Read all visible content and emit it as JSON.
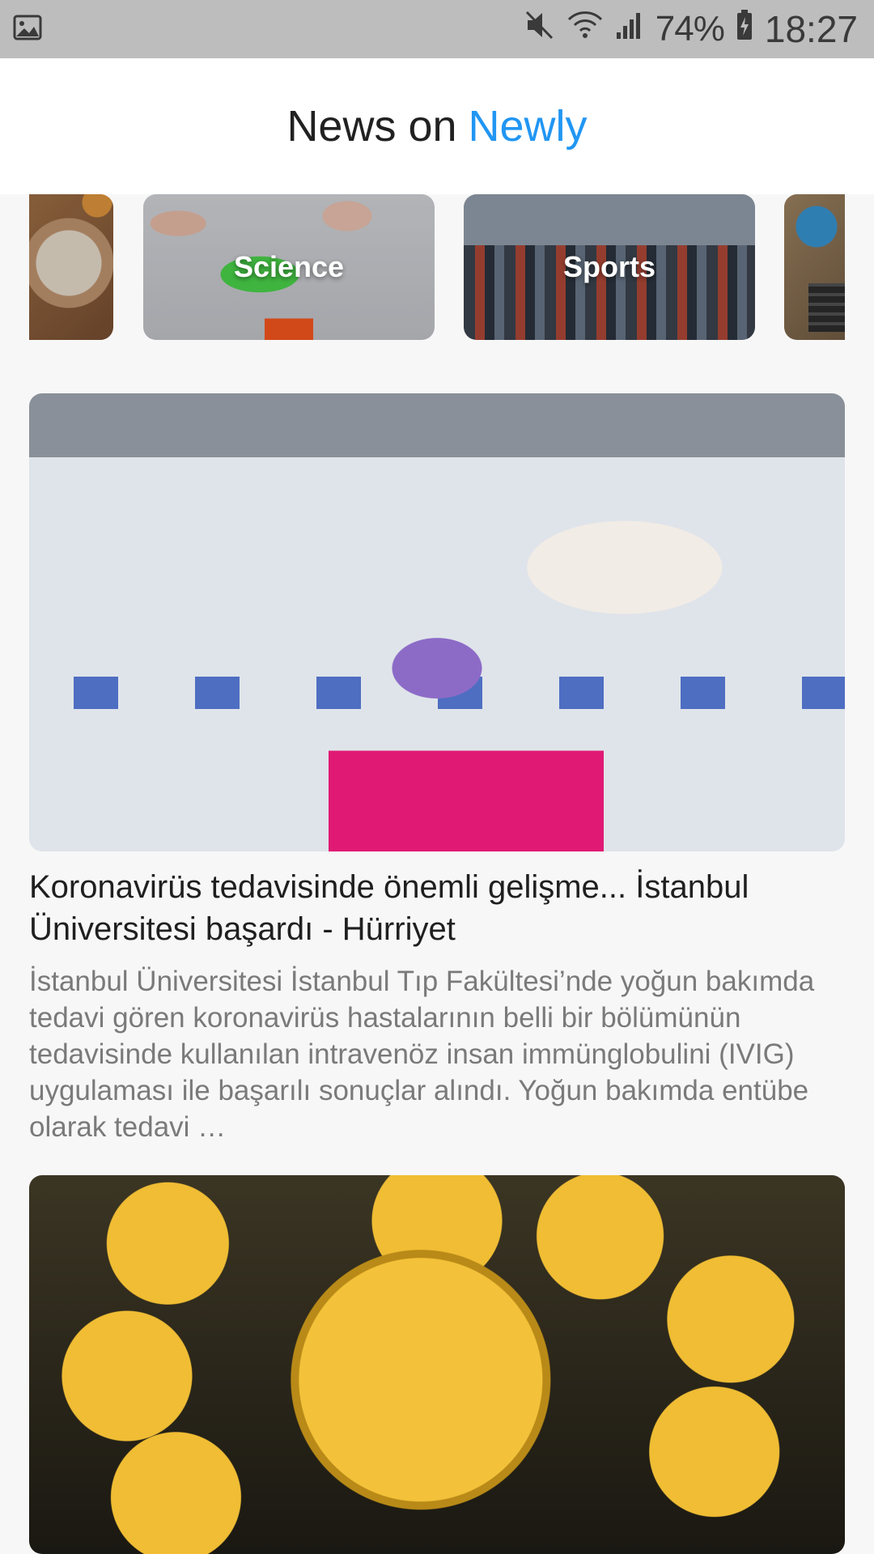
{
  "status_bar": {
    "battery": "74%",
    "time": "18:27",
    "icons": [
      "image-icon",
      "mute-icon",
      "wifi-icon",
      "signal-icon",
      "battery-charging-icon"
    ]
  },
  "header": {
    "title_prefix": "News on",
    "brand": "Newly"
  },
  "categories": [
    {
      "label": "",
      "image": "food-photo"
    },
    {
      "label": "Science",
      "image": "science-photo"
    },
    {
      "label": "Sports",
      "image": "sports-photo"
    },
    {
      "label": "",
      "image": "tech-photo"
    }
  ],
  "articles": [
    {
      "title": "Koronavirüs tedavisinde önemli gelişme... İstanbul Üniversitesi başardı - Hürriyet",
      "description": "İstanbul Üniversitesi İstanbul Tıp Fakültesi’nde yoğun bakımda tedavi gören koronavirüs hastalarının belli bir bölümünün tedavisinde kullanılan intravenöz insan immünglobulini (IVIG) uygulaması ile başarılı sonuçlar alındı. Yoğun bakımda entübe olarak tedavi …",
      "image": "lab-scientist-photo"
    },
    {
      "title": "",
      "description": "",
      "image": "gold-coins-photo"
    }
  ],
  "colors": {
    "brand": "#2196f3",
    "status_bar": "#bdbdbd",
    "background": "#f7f7f7"
  }
}
